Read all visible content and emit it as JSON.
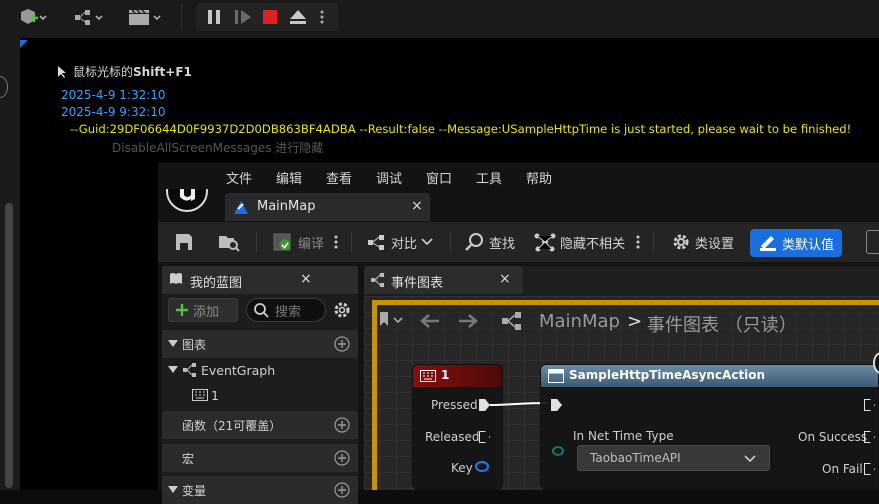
{
  "top_toolbar": {
    "buttons": [
      "add-actor",
      "blueprint",
      "cinematics",
      "pause",
      "step",
      "stop",
      "eject",
      "more"
    ]
  },
  "debug": {
    "hint_label": "鼠标光标的",
    "hint_key": "Shift+F1",
    "line1": "2025-4-9  1:32:10",
    "line2": "2025-4-9  9:32:10",
    "line3": "--Guid:29DF06644D0F9937D2D0DB863BF4ADBA   --Result:false   --Message:USampleHttpTime is just started, please wait to be finished!",
    "line4": "DisableAllScreenMessages 进行隐藏",
    "colors": {
      "time": "#2aa6ff",
      "message": "#e6e600"
    }
  },
  "menu": [
    "文件",
    "编辑",
    "查看",
    "调试",
    "窗口",
    "工具",
    "帮助"
  ],
  "tab": {
    "label": "MainMap",
    "close": "×"
  },
  "toolbar": {
    "compile": "编译",
    "diff": "对比",
    "find": "查找",
    "hide_unrelated": "隐藏不相关",
    "class_settings": "类设置",
    "class_defaults": "类默认值"
  },
  "mybp": {
    "title": "我的蓝图",
    "close": "×",
    "add": "添加",
    "search_placeholder": "搜索",
    "sections": {
      "graphs": "图表",
      "event_graph": "EventGraph",
      "event_item": "1",
      "functions": "函数（21可覆盖）",
      "macros": "宏",
      "variables": "变量"
    }
  },
  "graph_tab": {
    "title": "事件图表",
    "close": "×"
  },
  "breadcrumb": {
    "root": "MainMap",
    "sep": ">",
    "current": "事件图表 （只读）"
  },
  "nodes": {
    "key_node": {
      "title": "1",
      "pins": [
        "Pressed",
        "Released",
        "Key"
      ]
    },
    "async_node": {
      "title": "SampleHttpTimeAsyncAction",
      "in_label": "In Net Time Type",
      "dropdown": "TaobaoTimeAPI",
      "outputs": [
        "On Success",
        "On Fail"
      ]
    }
  },
  "accent": "#1a6fe0"
}
